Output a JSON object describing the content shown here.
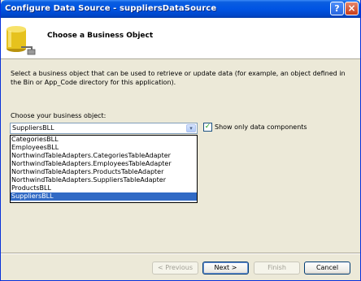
{
  "window": {
    "title": "Configure Data Source - suppliersDataSource",
    "help_icon": "?",
    "close_icon": "×"
  },
  "header": {
    "title": "Choose a Business Object"
  },
  "description": "Select a business object that can be used to retrieve or update data (for example, an object defined in the Bin or App_Code directory for this application).",
  "business_object": {
    "label": "Choose your business object:",
    "selected": "SuppliersBLL",
    "dropdown_icon": "▾",
    "options": [
      "CategoriesBLL",
      "EmployeesBLL",
      "NorthwindTableAdapters.CategoriesTableAdapter",
      "NorthwindTableAdapters.EmployeesTableAdapter",
      "NorthwindTableAdapters.ProductsTableAdapter",
      "NorthwindTableAdapters.SuppliersTableAdapter",
      "ProductsBLL",
      "SuppliersBLL"
    ],
    "highlighted_index": 7
  },
  "filter": {
    "label": "Show only data components",
    "checked": true,
    "check_glyph": "✓"
  },
  "buttons": {
    "previous": "< Previous",
    "next": "Next >",
    "finish": "Finish",
    "cancel": "Cancel"
  },
  "colors": {
    "title_bar": "#0054e3",
    "selection": "#316ac5",
    "dialog_bg": "#ece9d8"
  }
}
